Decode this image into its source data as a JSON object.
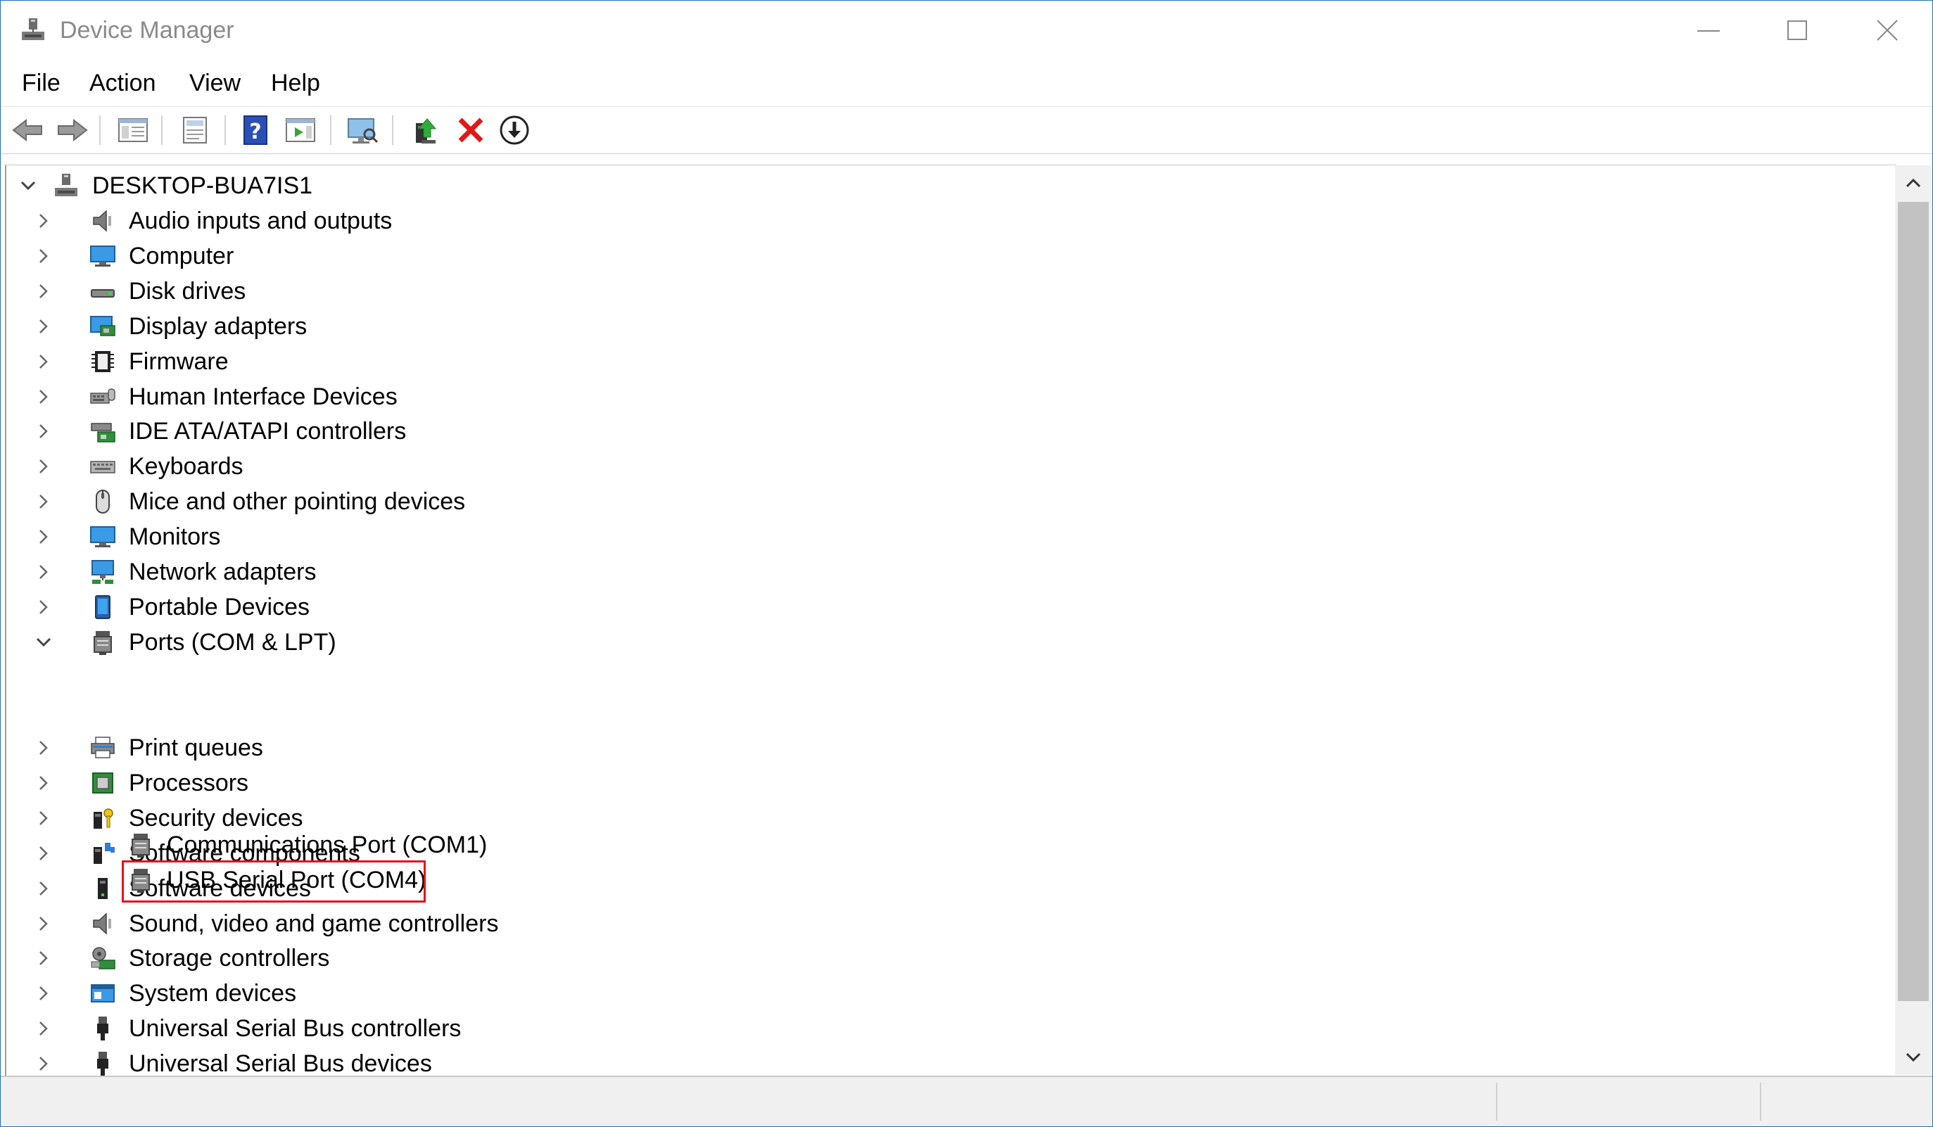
{
  "window": {
    "title": "Device Manager"
  },
  "menu": {
    "file": "File",
    "action": "Action",
    "view": "View",
    "help": "Help"
  },
  "toolbar": {
    "buttons": [
      "back-icon",
      "forward-icon",
      "properties-grid-icon",
      "properties-sheet-icon",
      "help-icon",
      "run-view-icon",
      "monitor-scan-icon",
      "update-driver-icon",
      "uninstall-icon",
      "download-icon"
    ]
  },
  "tree": {
    "root": "DESKTOP-BUA7IS1",
    "categories": [
      {
        "label": "Audio inputs and outputs",
        "icon": "speaker-icon"
      },
      {
        "label": "Computer",
        "icon": "computer-icon"
      },
      {
        "label": "Disk drives",
        "icon": "disk-drive-icon"
      },
      {
        "label": "Display adapters",
        "icon": "display-adapter-icon"
      },
      {
        "label": "Firmware",
        "icon": "firmware-icon"
      },
      {
        "label": "Human Interface Devices",
        "icon": "hid-icon"
      },
      {
        "label": "IDE ATA/ATAPI controllers",
        "icon": "ide-controller-icon"
      },
      {
        "label": "Keyboards",
        "icon": "keyboard-icon"
      },
      {
        "label": "Mice and other pointing devices",
        "icon": "mouse-icon"
      },
      {
        "label": "Monitors",
        "icon": "monitor-icon"
      },
      {
        "label": "Network adapters",
        "icon": "network-adapter-icon"
      },
      {
        "label": "Portable Devices",
        "icon": "portable-device-icon"
      },
      {
        "label": "Ports (COM & LPT)",
        "icon": "port-icon",
        "expanded": true
      },
      {
        "label": "Print queues",
        "icon": "printer-icon"
      },
      {
        "label": "Processors",
        "icon": "processor-icon"
      },
      {
        "label": "Security devices",
        "icon": "security-device-icon"
      },
      {
        "label": "Software components",
        "icon": "software-component-icon"
      },
      {
        "label": "Software devices",
        "icon": "software-device-icon"
      },
      {
        "label": "Sound, video and game controllers",
        "icon": "sound-icon"
      },
      {
        "label": "Storage controllers",
        "icon": "storage-controller-icon"
      },
      {
        "label": "System devices",
        "icon": "system-device-icon"
      },
      {
        "label": "Universal Serial Bus controllers",
        "icon": "usb-icon"
      },
      {
        "label": "Universal Serial Bus devices",
        "icon": "usb-icon"
      }
    ],
    "ports_children": [
      {
        "label": "Communications Port (COM1)",
        "icon": "port-icon"
      },
      {
        "label": "USB Serial Port (COM4)",
        "icon": "port-icon",
        "highlighted": true
      }
    ]
  },
  "colors": {
    "highlight_border": "#e0141e",
    "window_border": "#1f6fb5"
  }
}
